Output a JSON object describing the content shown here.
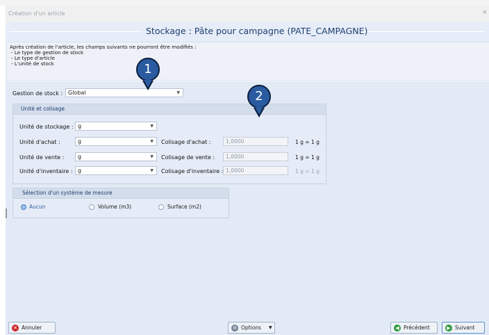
{
  "window": {
    "title": "Création d'un article",
    "close_glyph": "×"
  },
  "header": {
    "title": "Stockage : Pâte pour campagne (PATE_CAMPAGNE)"
  },
  "info": {
    "intro": "Après création de l'article, les champs suivants ne pourront être modifiés :",
    "items": [
      "- Le type de gestion de stock",
      "- Le type d'article",
      "- L'unité de stock"
    ]
  },
  "markers": {
    "first": "1",
    "second": "2"
  },
  "stock_management": {
    "label": "Gestion de stock :",
    "value": "Global"
  },
  "units_group": {
    "title": "Unité et colisage",
    "storage": {
      "label": "Unité de stockage :",
      "value": "g"
    },
    "purchase": {
      "label": "Unité d'achat :",
      "value": "g",
      "pack_label": "Colisage d'achat :",
      "pack_value": "1,0000",
      "ratio": "1 g = 1 g"
    },
    "sale": {
      "label": "Unité de vente :",
      "value": "g",
      "pack_label": "Colisage de vente :",
      "pack_value": "1,0000",
      "ratio": "1 g = 1 g"
    },
    "inventory": {
      "label": "Unité d'inventaire :",
      "value": "g",
      "pack_label": "Colisage d'inventaire :",
      "pack_value": "1,0000",
      "ratio": "1 g = 1 g"
    }
  },
  "measure_group": {
    "title": "Sélection d'un système de mesure",
    "options": [
      {
        "label": "Aucun",
        "selected": true
      },
      {
        "label": "Volume (m3)",
        "selected": false
      },
      {
        "label": "Surface (m2)",
        "selected": false
      }
    ]
  },
  "footer": {
    "cancel_label": "Annuler",
    "options_label": "Options",
    "previous_label": "Précédent",
    "next_label": "Suivant"
  },
  "colors": {
    "accent": "#2a5ba0",
    "header_text": "#1f3f6e",
    "background": "#e2eaf6"
  },
  "icons": {
    "cancel": "cancel-x-icon",
    "options": "options-gear-icon",
    "previous": "arrow-left-icon",
    "next": "arrow-right-icon"
  }
}
